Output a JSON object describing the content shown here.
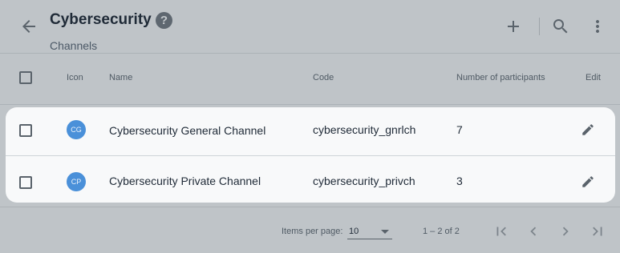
{
  "header": {
    "title": "Cybersecurity",
    "help_symbol": "?",
    "subtitle": "Channels"
  },
  "icons": {
    "back": "arrow-back-icon",
    "help": "help-circle-icon",
    "add": "plus-icon",
    "search": "search-icon",
    "more": "more-vert-icon",
    "edit": "pencil-icon",
    "first": "first-page-icon",
    "prev": "chevron-left-icon",
    "next": "chevron-right-icon",
    "last": "last-page-icon"
  },
  "table": {
    "columns": {
      "icon": "Icon",
      "name": "Name",
      "code": "Code",
      "participants": "Number of participants",
      "edit": "Edit"
    },
    "rows": [
      {
        "initials": "CG",
        "name": "Cybersecurity General Channel",
        "code": "cybersecurity_gnrlch",
        "participants": "7"
      },
      {
        "initials": "CP",
        "name": "Cybersecurity Private Channel",
        "code": "cybersecurity_privch",
        "participants": "3"
      }
    ]
  },
  "paginator": {
    "items_per_page_label": "Items per page:",
    "items_per_page_value": "10",
    "range_label": "1 – 2 of 2"
  },
  "colors": {
    "background_overlay": "#bfc4c8",
    "row_highlight": "#f8f9fa",
    "avatar": "#4a90d9"
  }
}
